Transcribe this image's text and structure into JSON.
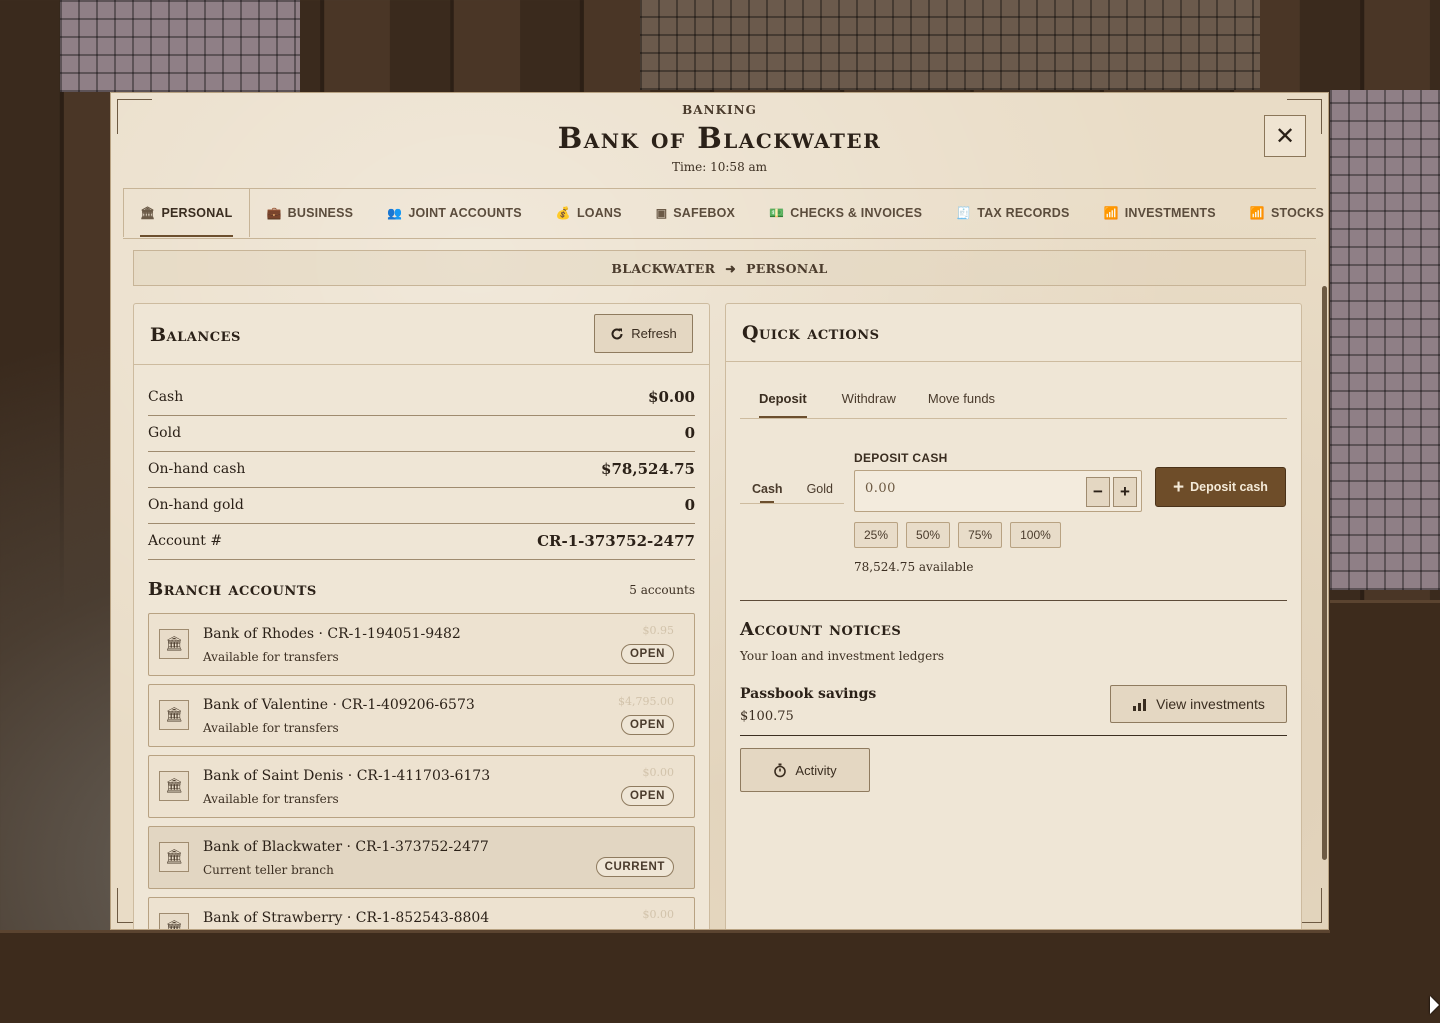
{
  "header": {
    "kicker": "BANKING",
    "title": "Bank of Blackwater",
    "time": "Time: 10:58 am",
    "close_icon": "✕"
  },
  "tabs": [
    {
      "label": "PERSONAL",
      "icon": "bank-icon",
      "glyph": "🏛"
    },
    {
      "label": "BUSINESS",
      "icon": "briefcase-icon",
      "glyph": "💼"
    },
    {
      "label": "JOINT ACCOUNTS",
      "icon": "people-icon",
      "glyph": "👥"
    },
    {
      "label": "LOANS",
      "icon": "coins-icon",
      "glyph": "💰"
    },
    {
      "label": "SAFEBOX",
      "icon": "safe-icon",
      "glyph": "▣"
    },
    {
      "label": "CHECKS & INVOICES",
      "icon": "money-icon",
      "glyph": "💵"
    },
    {
      "label": "TAX RECORDS",
      "icon": "receipt-icon",
      "glyph": "🧾"
    },
    {
      "label": "INVESTMENTS",
      "icon": "chart-icon",
      "glyph": "📶"
    },
    {
      "label": "STOCKS",
      "icon": "chart-icon",
      "glyph": "📶"
    }
  ],
  "breadcrumb": {
    "from": "BLACKWATER",
    "arrow": "➜",
    "to": "PERSONAL"
  },
  "balances": {
    "title": "Balances",
    "refresh_label": "Refresh",
    "rows": [
      {
        "label": "Cash",
        "value": "$0.00"
      },
      {
        "label": "Gold",
        "value": "0"
      },
      {
        "label": "On-hand cash",
        "value": "$78,524.75"
      },
      {
        "label": "On-hand gold",
        "value": "0"
      },
      {
        "label": "Account #",
        "value": "CR-1-373752-2477"
      }
    ]
  },
  "branches": {
    "title": "Branch accounts",
    "count": "5 accounts",
    "items": [
      {
        "name": "Bank of Rhodes · CR-1-194051-9482",
        "sub": "Available for transfers",
        "balance": "$0.95",
        "badge": "OPEN"
      },
      {
        "name": "Bank of Valentine · CR-1-409206-6573",
        "sub": "Available for transfers",
        "balance": "$4,795.00",
        "badge": "OPEN"
      },
      {
        "name": "Bank of Saint Denis · CR-1-411703-6173",
        "sub": "Available for transfers",
        "balance": "$0.00",
        "badge": "OPEN"
      },
      {
        "name": "Bank of Blackwater · CR-1-373752-2477",
        "sub": "Current teller branch",
        "balance": "",
        "badge": "CURRENT"
      },
      {
        "name": "Bank of Strawberry · CR-1-852543-8804",
        "sub": "",
        "balance": "$0.00",
        "badge": ""
      }
    ]
  },
  "quick_actions": {
    "title": "Quick actions",
    "subtabs": [
      "Deposit",
      "Withdraw",
      "Move funds"
    ],
    "currency_tabs": [
      "Cash",
      "Gold"
    ],
    "deposit_label": "DEPOSIT CASH",
    "amount_placeholder": "0.00",
    "minus": "−",
    "plus": "+",
    "deposit_button": "Deposit cash",
    "percents": [
      "25%",
      "50%",
      "75%",
      "100%"
    ],
    "available": "78,524.75 available"
  },
  "notices": {
    "title": "Account notices",
    "subtitle": "Your loan and investment ledgers",
    "passbook_title": "Passbook savings",
    "passbook_value": "$100.75",
    "view_investments": "View investments",
    "activity": "Activity"
  },
  "colors": {
    "accent": "#6e4d29",
    "parchment": "#e9dcc6",
    "ink": "#2b2118"
  }
}
